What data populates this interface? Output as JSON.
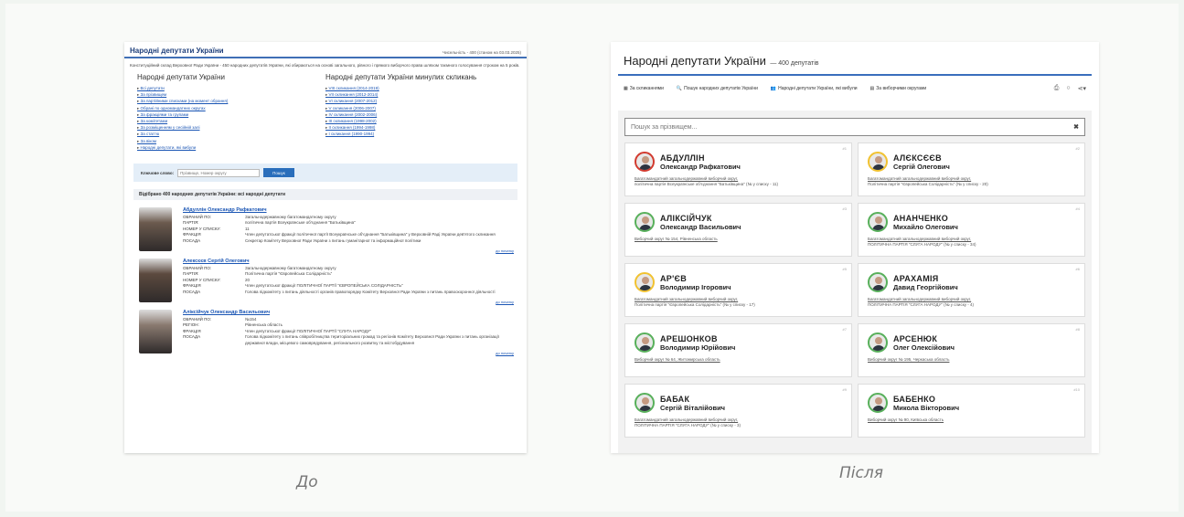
{
  "before": {
    "title": "Народні депутати України",
    "count_text": "Чисельність - 400 (станом на 03.03.2025)",
    "intro": "Конституційний склад Верховної Ради України - 450 народних депутатів України, які обираються на основі загального, рівного і прямого виборчого права шляхом таємного голосування строком на 5 років.",
    "col1_title": "Народні депутати України",
    "col1_links": [
      "Всі депутати",
      "За прізвищем",
      "За партійними списками (на момент обрання)",
      "Обрані по одномандатних округах",
      "За фракціями та групами",
      "За комітетами",
      "За розміщенням у сесійній залі",
      "За статтю",
      "За віком",
      "Народні депутати, які вибули"
    ],
    "col2_title": "Народні депутати України минулих скликань",
    "col2_links": [
      "VIII скликання (2014-2019)",
      "VII скликання (2012-2014)",
      "VI скликання (2007-2012)",
      "V скликання (2006-2007)",
      "IV скликання (2002-2006)",
      "III скликання (1998-2002)",
      "II скликання (1994-1998)",
      "I скликання (1990-1994)"
    ],
    "search_label": "Ключове слово:",
    "search_placeholder": "Прізвище, Номер округу",
    "search_button": "Пошук",
    "selected_text": "Відібрано 400 народних депутатів України: всі народні депутати",
    "to_top": "до початку",
    "deputies": [
      {
        "name": "Абдуллін Олександр Рафкатович",
        "rows": [
          {
            "k": "ОБРАНИЙ ПО:",
            "v": "Загальнодержавному багатомандатному округу"
          },
          {
            "k": "ПАРТІЯ:",
            "v": "політична партія Всеукраїнське об'єднання \"Батьківщина\""
          },
          {
            "k": "НОМЕР У СПИСКУ:",
            "v": "11"
          },
          {
            "k": "ФРАКЦІЯ",
            "v": "Член депутатської фракції політичної партії Всеукраїнське об'єднання \"Батьківщина\" у Верховній Раді України дев'ятого скликання"
          },
          {
            "k": "ПОСАДА",
            "v": "Секретар Комітету Верховної Ради України з питань гуманітарної та інформаційної політики"
          }
        ]
      },
      {
        "name": "Алексєєв Сергій Олегович",
        "rows": [
          {
            "k": "ОБРАНИЙ ПО:",
            "v": "Загальнодержавному багатомандатному округу"
          },
          {
            "k": "ПАРТІЯ:",
            "v": "Політична партія \"Європейська Солідарність\""
          },
          {
            "k": "НОМЕР У СПИСКУ:",
            "v": "20"
          },
          {
            "k": "ФРАКЦІЯ",
            "v": "Член депутатської фракції ПОЛІТИЧНОЇ ПАРТІЇ \"ЄВРОПЕЙСЬКА СОЛІДАРНІСТЬ\""
          },
          {
            "k": "ПОСАДА",
            "v": "Голова підкомітету з питань діяльності органів правопорядку Комітету Верховної Ради України з питань правоохоронної діяльності"
          }
        ]
      },
      {
        "name": "Аліксійчук Олександр Васильович",
        "rows": [
          {
            "k": "ОБРАНИЙ ПО:",
            "v": "№154"
          },
          {
            "k": "РЕГІОН:",
            "v": "Рівненська область"
          },
          {
            "k": "ФРАКЦІЯ",
            "v": "Член депутатської фракції ПОЛІТИЧНОЇ ПАРТІЇ \"СЛУГА НАРОДУ\""
          },
          {
            "k": "ПОСАДА",
            "v": "Голова підкомітету з питань співробітництва територіальних громад та регіонів Комітету Верховної Ради України з питань організації державної влади, місцевого самоврядування, регіонального розвитку та містобудування"
          }
        ]
      }
    ]
  },
  "after": {
    "title": "Народні депутати України",
    "count_text": "— 400 депутатів",
    "nav": [
      "За скликаннями",
      "Пошук народних депутатів України",
      "Народні депутати України, які вибули",
      "За виборчими округами"
    ],
    "nav_icons": [
      "calendar-icon",
      "search-icon",
      "users-icon",
      "map-icon"
    ],
    "search_placeholder": "Пошук за прізвищем...",
    "search_clear": "✖",
    "cards": [
      {
        "num": "#1",
        "surname": "АБДУЛЛІН",
        "given": "Олександр Рафкатович",
        "line1": "Багатомандатний загальнодержавний виборчий округ,",
        "line2": "політична партія Всеукраїнське об'єднання \"Батьківщина\" (№ у списку - 11)",
        "color": "#d23b2f"
      },
      {
        "num": "#2",
        "surname": "АЛЄКСЄЄВ",
        "given": "Сергій Олегович",
        "line1": "Багатомандатний загальнодержавний виборчий округ,",
        "line2": "Політична партія \"Європейська Солідарність\" (№ у списку - 20)",
        "color": "#f1c231"
      },
      {
        "num": "#3",
        "surname": "АЛІКСІЙЧУК",
        "given": "Олександр Васильович",
        "line1": "Виборчий округ № 154, Рівненська область",
        "line2": "",
        "color": "#58b05b"
      },
      {
        "num": "#4",
        "surname": "АНАНЧЕНКО",
        "given": "Михайло Олегович",
        "line1": "Багатомандатний загальнодержавний виборчий округ,",
        "line2": "ПОЛІТИЧНА ПАРТІЯ \"СЛУГА НАРОДУ\" (№ у списку - 34)",
        "color": "#58b05b"
      },
      {
        "num": "#5",
        "surname": "АР'ЄВ",
        "given": "Володимир Ігорович",
        "line1": "Багатомандатний загальнодержавний виборчий округ,",
        "line2": "Політична партія \"Європейська Солідарність\" (№ у списку - 17)",
        "color": "#f1c231"
      },
      {
        "num": "#6",
        "surname": "АРАХАМІЯ",
        "given": "Давид Георгійович",
        "line1": "Багатомандатний загальнодержавний виборчий округ,",
        "line2": "ПОЛІТИЧНА ПАРТІЯ \"СЛУГА НАРОДУ\" (№ у списку - 4)",
        "color": "#58b05b"
      },
      {
        "num": "#7",
        "surname": "АРЕШОНКОВ",
        "given": "Володимир Юрійович",
        "line1": "Виборчий округ № 64, Житомирська область",
        "line2": "",
        "color": "#58b05b"
      },
      {
        "num": "#8",
        "surname": "АРСЕНЮК",
        "given": "Олег Олексійович",
        "line1": "Виборчий округ № 195, Черкаська область",
        "line2": "",
        "color": "#58b05b"
      },
      {
        "num": "#9",
        "surname": "БАБАК",
        "given": "Сергій Віталійович",
        "line1": "Багатомандатний загальнодержавний виборчий округ,",
        "line2": "ПОЛІТИЧНА ПАРТІЯ \"СЛУГА НАРОДУ\" (№ у списку - 3)",
        "color": "#58b05b"
      },
      {
        "num": "#10",
        "surname": "БАБЕНКО",
        "given": "Микола Вікторович",
        "line1": "Виборчий округ № 90, Київська область",
        "line2": "",
        "color": "#58b05b"
      }
    ]
  },
  "captions": {
    "before": "До",
    "after": "Після"
  }
}
